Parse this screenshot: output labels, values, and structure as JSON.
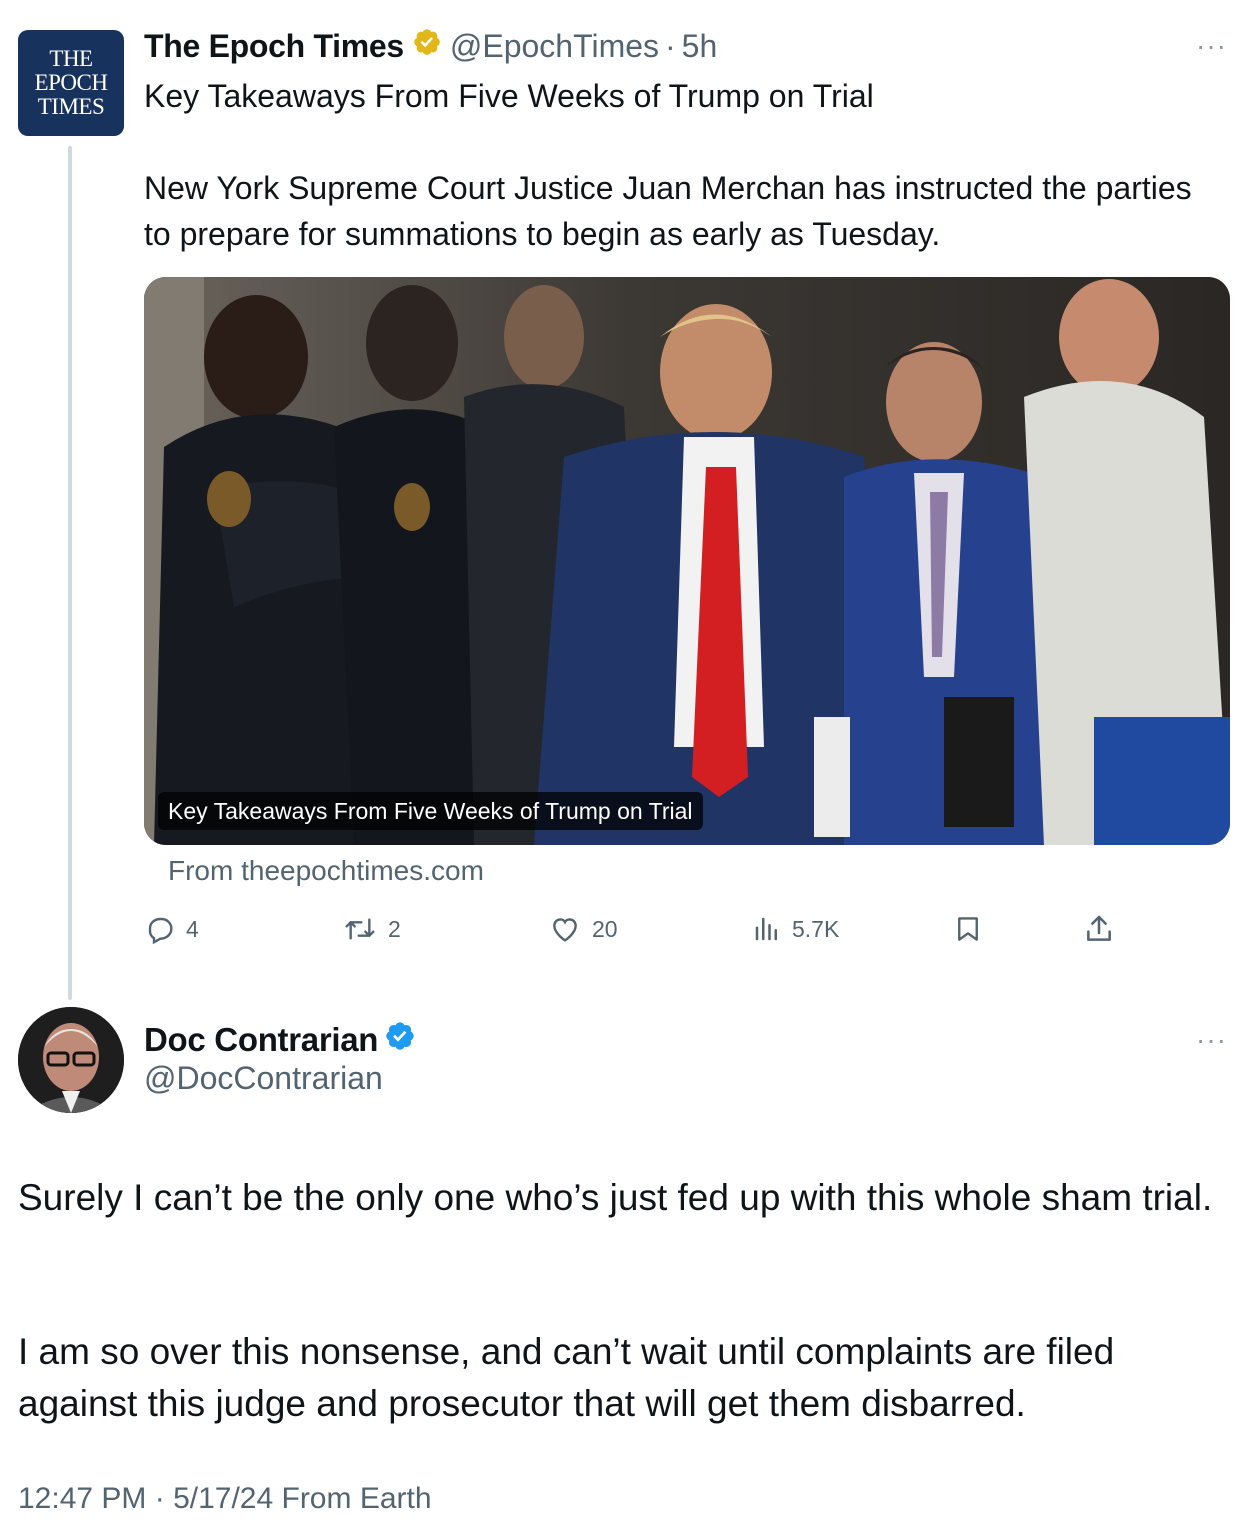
{
  "quoted_tweet": {
    "logo_lines": [
      "THE",
      "EPOCH",
      "TIMES"
    ],
    "author_name": "The Epoch Times",
    "verified_badge": "gold-verified-badge-icon",
    "handle": "@EpochTimes",
    "separator": "·",
    "time": "5h",
    "more": "···",
    "headline": "Key Takeaways From Five Weeks of Trump on Trial",
    "body": "New York Supreme Court Justice Juan Merchan has instructed the parties to prepare for summations to begin as early as Tuesday.",
    "card": {
      "image_caption": "Key Takeaways From Five Weeks of Trump on Trial",
      "source": "From theepochtimes.com"
    },
    "actions": {
      "replies": "4",
      "reposts": "2",
      "likes": "20",
      "views": "5.7K"
    }
  },
  "main_tweet": {
    "author_name": "Doc Contrarian",
    "verified_badge": "blue-verified-badge-icon",
    "handle": "@DocContrarian",
    "more": "···",
    "paragraph_1": "Surely I can’t be the only one who’s just fed up with this whole sham trial.",
    "paragraph_2": "I am so over this nonsense, and can’t wait until complaints are filed against this judge and prosecutor that will get them disbarred.",
    "timestamp": "12:47 PM · 5/17/24 From Earth"
  },
  "colors": {
    "text": "#0f1419",
    "secondary": "#536471",
    "thread_line": "#cfd9de",
    "verified_blue": "#1d9bf0",
    "verified_gold": "#e2b719",
    "epoch_navy": "#17325c"
  }
}
